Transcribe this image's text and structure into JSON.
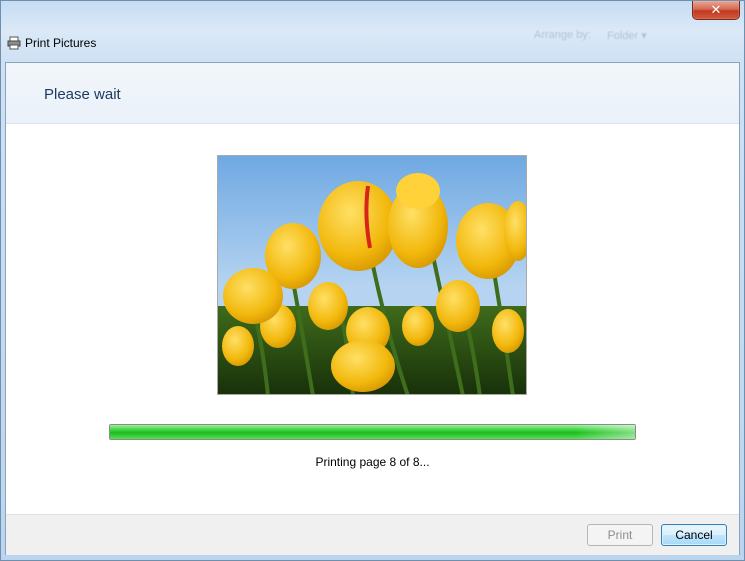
{
  "window": {
    "title": "Print Pictures",
    "close_glyph": "✕"
  },
  "background": {
    "arrange_label": "Arrange by:",
    "arrange_value": "Folder ▾"
  },
  "header": {
    "title": "Please wait"
  },
  "preview": {
    "description_icon": "tulips-image"
  },
  "progress": {
    "fraction": 1.0
  },
  "status": {
    "text": "Printing page 8 of 8..."
  },
  "footer": {
    "print_label": "Print",
    "cancel_label": "Cancel"
  },
  "colors": {
    "progress_green": "#1ebd1e",
    "header_text": "#1e3a5f",
    "tulip_yellow": "#f2b80c",
    "sky_blue": "#8bbdea"
  }
}
